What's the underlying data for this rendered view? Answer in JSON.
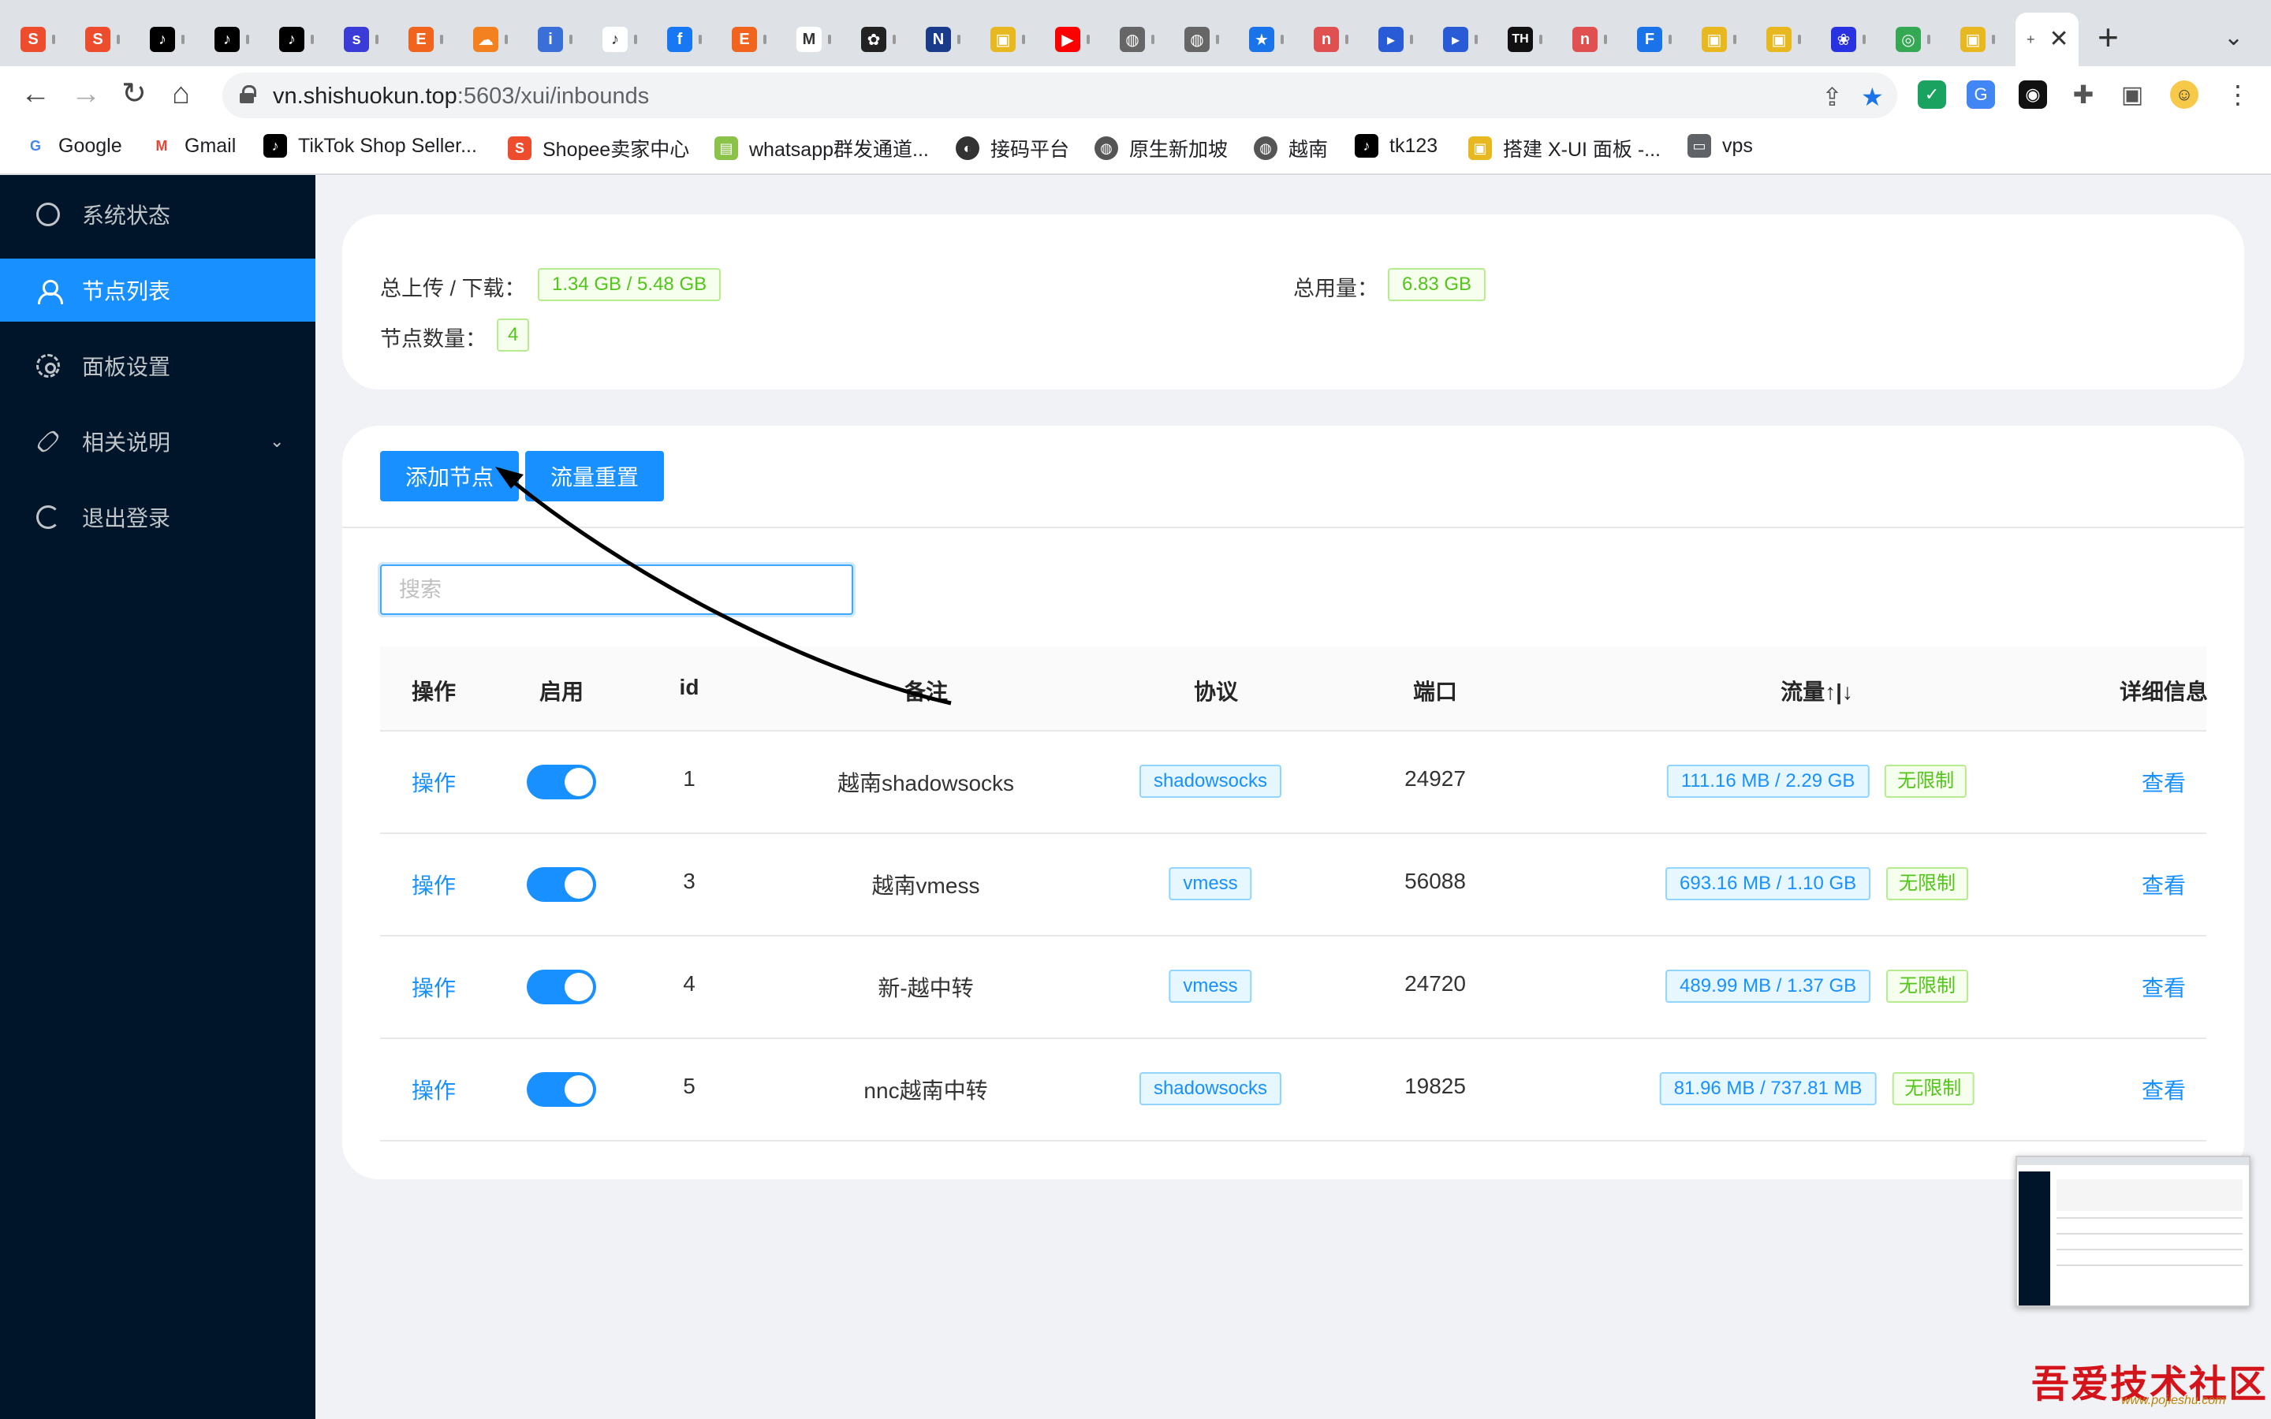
{
  "browser": {
    "tabs": [
      {
        "icon": "shopee-icon",
        "color": "#ee4d2d",
        "glyph": "S"
      },
      {
        "icon": "shopee-icon",
        "color": "#ee4d2d",
        "glyph": "S"
      },
      {
        "icon": "tiktok-icon",
        "color": "#000000",
        "glyph": "♪"
      },
      {
        "icon": "tiktok-icon",
        "color": "#000000",
        "glyph": "♪"
      },
      {
        "icon": "tiktok-icon",
        "color": "#000000",
        "glyph": "♪"
      },
      {
        "icon": "shield-icon",
        "color": "#3b3bd8",
        "glyph": "s"
      },
      {
        "icon": "etsy-icon",
        "color": "#f1641e",
        "glyph": "E"
      },
      {
        "icon": "cloudflare-icon",
        "color": "#f48120",
        "glyph": "☁"
      },
      {
        "icon": "info-icon",
        "color": "#3a6fd8",
        "glyph": "i"
      },
      {
        "icon": "tiktok-icon",
        "color": "#ffffff",
        "glyph": "♪"
      },
      {
        "icon": "facebook-icon",
        "color": "#1877f2",
        "glyph": "f"
      },
      {
        "icon": "etsy-icon",
        "color": "#f1641e",
        "glyph": "E"
      },
      {
        "icon": "gmail-icon",
        "color": "#ffffff",
        "glyph": "M"
      },
      {
        "icon": "openai-icon",
        "color": "#222222",
        "glyph": "✿"
      },
      {
        "icon": "app-icon",
        "color": "#1a3a8a",
        "glyph": "N"
      },
      {
        "icon": "vpn-icon",
        "color": "#e8b820",
        "glyph": "▣"
      },
      {
        "icon": "youtube-icon",
        "color": "#ff0000",
        "glyph": "▶"
      },
      {
        "icon": "globe-icon",
        "color": "#666666",
        "glyph": "◍"
      },
      {
        "icon": "globe-icon",
        "color": "#666666",
        "glyph": "◍"
      },
      {
        "icon": "star-icon",
        "color": "#1a73e8",
        "glyph": "★"
      },
      {
        "icon": "nnc-icon",
        "color": "#e05050",
        "glyph": "n"
      },
      {
        "icon": "pay-icon",
        "color": "#2a5bd7",
        "glyph": "▸"
      },
      {
        "icon": "pay-icon",
        "color": "#2a5bd7",
        "glyph": "▸"
      },
      {
        "icon": "th-icon",
        "color": "#111111",
        "glyph": "TH"
      },
      {
        "icon": "nnc-icon",
        "color": "#e05050",
        "glyph": "n"
      },
      {
        "icon": "f-icon",
        "color": "#1a73e8",
        "glyph": "F"
      },
      {
        "icon": "vpn-icon",
        "color": "#e8b820",
        "glyph": "▣"
      },
      {
        "icon": "vpn-icon",
        "color": "#e8b820",
        "glyph": "▣"
      },
      {
        "icon": "baidu-icon",
        "color": "#2932e1",
        "glyph": "❀"
      },
      {
        "icon": "chrome-icon",
        "color": "#34a853",
        "glyph": "◎"
      },
      {
        "icon": "vpn-icon",
        "color": "#e8b820",
        "glyph": "▣"
      }
    ],
    "active_tab_glyph": "+",
    "url_host": "vn.shishuokun.top",
    "url_path": ":5603/xui/inbounds",
    "bookmarks": [
      {
        "label": "Google",
        "icon": "google-icon",
        "color": "#4285f4",
        "glyph": "G"
      },
      {
        "label": "Gmail",
        "icon": "gmail-icon",
        "color": "#ea4335",
        "glyph": "M"
      },
      {
        "label": "TikTok Shop Seller...",
        "icon": "tiktok-icon",
        "color": "#000000",
        "glyph": "♪"
      },
      {
        "label": "Shopee卖家中心",
        "icon": "shopee-icon",
        "color": "#ee4d2d",
        "glyph": "S"
      },
      {
        "label": "whatsapp群发通道...",
        "icon": "whatsapp-icon",
        "color": "#8bc34a",
        "glyph": "▤"
      },
      {
        "label": "接码平台",
        "icon": "yin-yang-icon",
        "color": "#333333",
        "glyph": "◐"
      },
      {
        "label": "原生新加坡",
        "icon": "globe-icon",
        "color": "#555555",
        "glyph": "◍"
      },
      {
        "label": "越南",
        "icon": "globe-icon",
        "color": "#555555",
        "glyph": "◍"
      },
      {
        "label": "tk123",
        "icon": "tiktok-icon",
        "color": "#000000",
        "glyph": "♪"
      },
      {
        "label": "搭建 X-UI 面板 -...",
        "icon": "vpn-icon",
        "color": "#e8b820",
        "glyph": "▣"
      },
      {
        "label": "vps",
        "icon": "folder-icon",
        "color": "#5f6368",
        "glyph": "▭"
      }
    ]
  },
  "sidebar": {
    "items": [
      {
        "label": "系统状态",
        "icon": "dashboard-icon",
        "selected": false
      },
      {
        "label": "节点列表",
        "icon": "user-icon",
        "selected": true
      },
      {
        "label": "面板设置",
        "icon": "gear-icon",
        "selected": false
      },
      {
        "label": "相关说明",
        "icon": "link-icon",
        "selected": false,
        "has_submenu": true
      },
      {
        "label": "退出登录",
        "icon": "logout-icon",
        "selected": false
      }
    ]
  },
  "stats": {
    "upload_download_label": "总上传 / 下载：",
    "upload_download_value": "1.34 GB / 5.48 GB",
    "total_usage_label": "总用量：",
    "total_usage_value": "6.83 GB",
    "node_count_label": "节点数量：",
    "node_count_value": "4"
  },
  "actions": {
    "add_node": "添加节点",
    "reset_traffic": "流量重置",
    "search_placeholder": "搜索"
  },
  "table": {
    "headers": {
      "op": "操作",
      "enable": "启用",
      "id": "id",
      "remark": "备注",
      "protocol": "协议",
      "port": "端口",
      "traffic": "流量↑|↓",
      "detail": "详细信息"
    },
    "rows": [
      {
        "op": "操作",
        "enabled": true,
        "id": "1",
        "remark": "越南shadowsocks",
        "protocol": "shadowsocks",
        "port": "24927",
        "traffic": "111.16 MB / 2.29 GB",
        "limit": "无限制",
        "detail": "查看"
      },
      {
        "op": "操作",
        "enabled": true,
        "id": "3",
        "remark": "越南vmess",
        "protocol": "vmess",
        "port": "56088",
        "traffic": "693.16 MB / 1.10 GB",
        "limit": "无限制",
        "detail": "查看"
      },
      {
        "op": "操作",
        "enabled": true,
        "id": "4",
        "remark": "新-越中转",
        "protocol": "vmess",
        "port": "24720",
        "traffic": "489.99 MB / 1.37 GB",
        "limit": "无限制",
        "detail": "查看"
      },
      {
        "op": "操作",
        "enabled": true,
        "id": "5",
        "remark": "nnc越南中转",
        "protocol": "shadowsocks",
        "port": "19825",
        "traffic": "81.96 MB / 737.81 MB",
        "limit": "无限制",
        "detail": "查看"
      }
    ]
  },
  "watermark": {
    "text": "吾爱技术社区",
    "url": "www.pojieshu.com"
  }
}
